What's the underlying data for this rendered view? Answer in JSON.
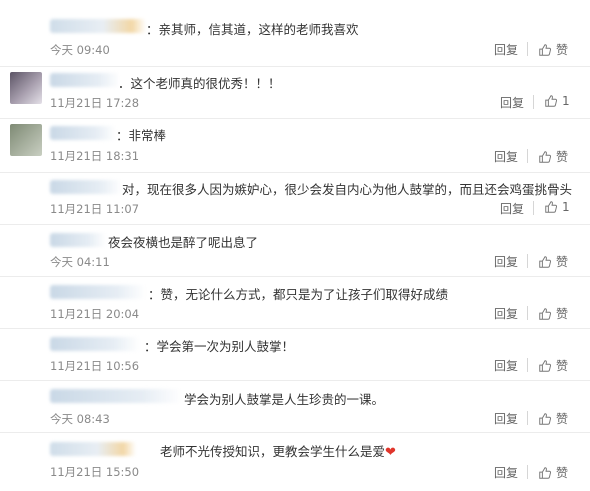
{
  "comments": [
    {
      "text": "：亲其师，信其道，这样的老师我喜欢",
      "time": "今天 09:40",
      "reply": "回复",
      "like": "赞"
    },
    {
      "text": "．这个老师真的很优秀！！！",
      "time": "11月21日 17:28",
      "reply": "回复",
      "like": "1"
    },
    {
      "text": "：非常棒",
      "time": "11月21日 18:31",
      "reply": "回复",
      "like": "赞"
    },
    {
      "text": "对，现在很多人因为嫉妒心，很少会发自内心为他人鼓掌的，而且还会鸡蛋挑骨头",
      "time": "11月21日 11:07",
      "reply": "回复",
      "like": "1"
    },
    {
      "text": "夜会夜横也是醉了呢出息了",
      "time": "今天 04:11",
      "reply": "回复",
      "like": "赞"
    },
    {
      "text": "：赞，无论什么方式，都只是为了让孩子们取得好成绩",
      "time": "11月21日 20:04",
      "reply": "回复",
      "like": "赞"
    },
    {
      "text": "：学会第一次为别人鼓掌！",
      "time": "11月21日 10:56",
      "reply": "回复",
      "like": "赞"
    },
    {
      "text": "学会为别人鼓掌是人生珍贵的一课。",
      "time": "今天 08:43",
      "reply": "回复",
      "like": "赞"
    },
    {
      "text": "老师不光传授知识，更教会学生什么是爱",
      "time": "11月21日 15:50",
      "reply": "回复",
      "like": "赞"
    }
  ],
  "icons": {
    "like": "thumbs-up-icon",
    "heart": "heart-icon"
  },
  "colors": {
    "heart": "#e0352b"
  }
}
